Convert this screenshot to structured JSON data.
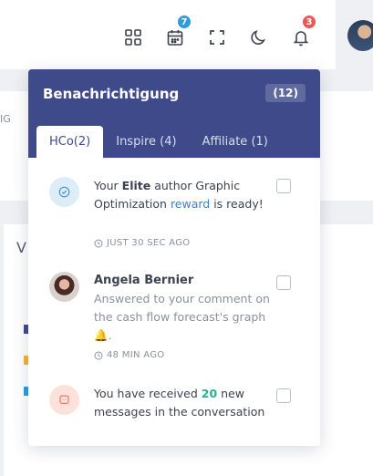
{
  "header": {
    "calendar_badge": "7",
    "bell_badge": "3",
    "colors": {
      "calendar_badge": "#2d9cdb",
      "bell_badge": "#eb5757"
    }
  },
  "background": {
    "text_ig": "IG",
    "text_v": "V"
  },
  "notifications": {
    "title": "Benachrichtigung",
    "count": "(12)",
    "tabs": [
      {
        "label": "HCo(2)",
        "active": true
      },
      {
        "label": "Inspire (4)",
        "active": false
      },
      {
        "label": "Affiliate (1)",
        "active": false
      }
    ],
    "items": [
      {
        "icon": "badge-check-icon",
        "text_before": "Your ",
        "bold": "Elite",
        "text_mid": " author Graphic Optimization ",
        "link": "reward",
        "text_after": " is ready!",
        "time": "JUST 30 SEC AGO"
      },
      {
        "icon": "user-avatar",
        "name": "Angela Bernier",
        "sub": "Answered to your comment on the cash flow forecast's graph",
        "emoji": "🔔",
        "time": "48 MIN AGO"
      },
      {
        "icon": "chat-icon",
        "text_before": "You have received ",
        "number": "20",
        "text_after": " new messages in the conversation"
      }
    ],
    "colors": {
      "header": "#3f4a8a",
      "link": "#3d7be0",
      "number": "#26b28a"
    }
  }
}
